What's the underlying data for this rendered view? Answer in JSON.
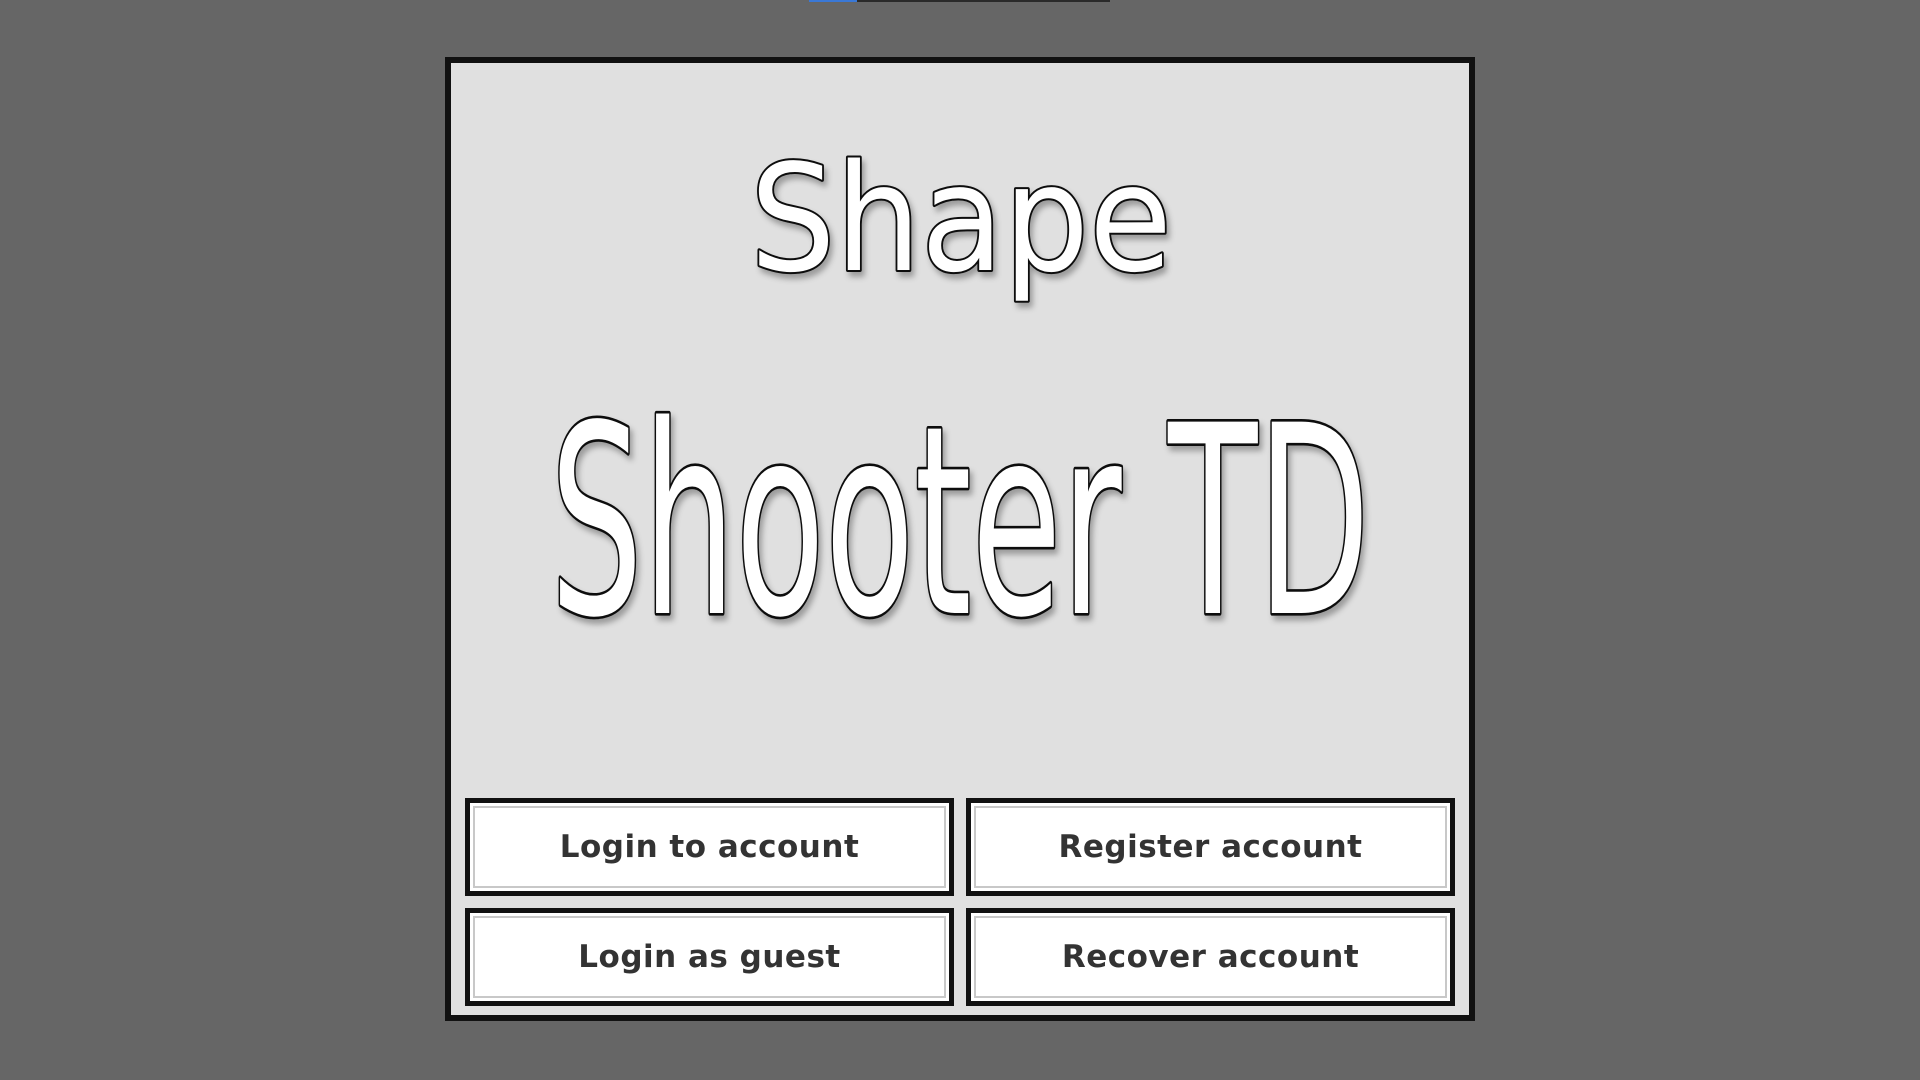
{
  "loading_progress": 0.16,
  "title": {
    "line1": "Shape",
    "line2": "Shooter TD"
  },
  "buttons": {
    "login": "Login to account",
    "register": "Register account",
    "guest": "Login as guest",
    "recover": "Recover account"
  },
  "colors": {
    "background": "#666666",
    "panel": "#e0e0e0",
    "border": "#111111",
    "button_fill": "#ffffff",
    "button_text": "#333333",
    "logo_fill": "#ffffff",
    "logo_stroke": "#111111",
    "progress": "#3a78d6"
  }
}
